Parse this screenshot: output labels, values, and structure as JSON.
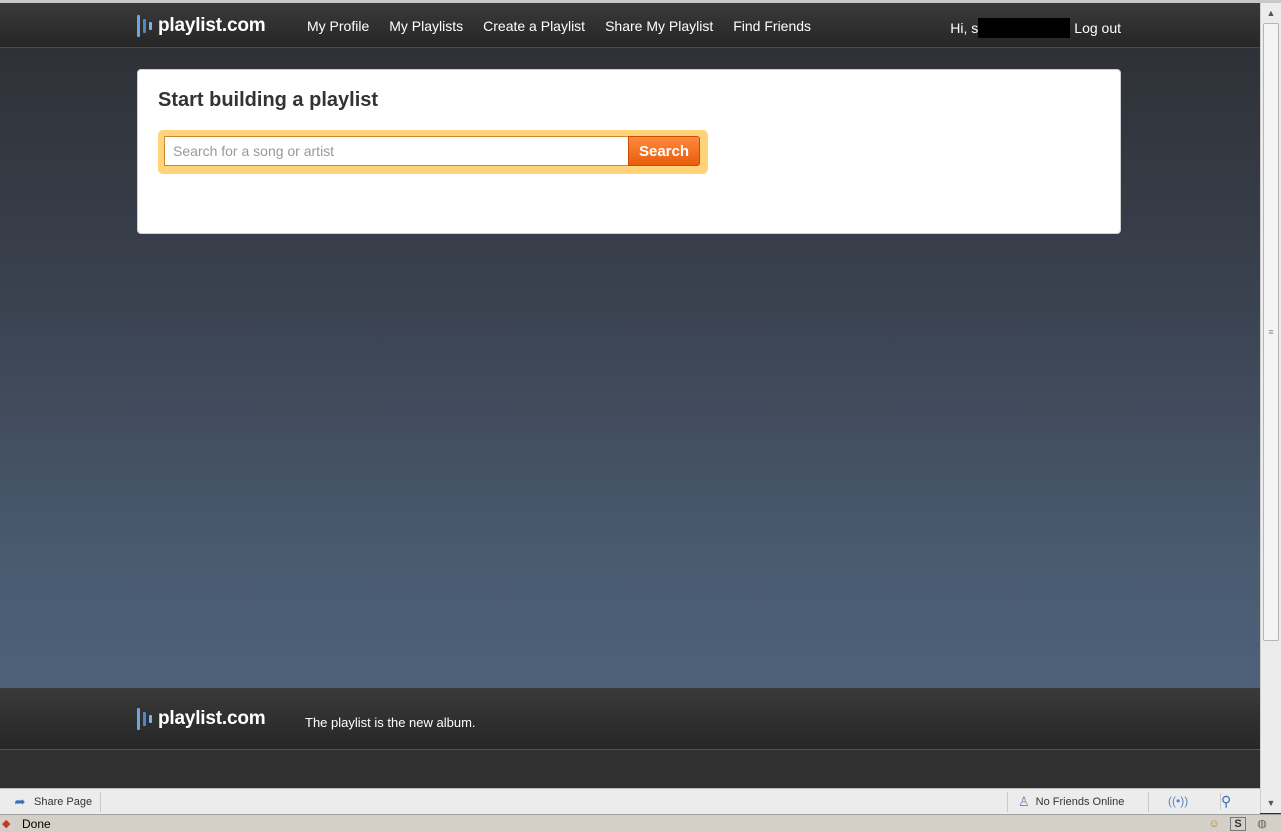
{
  "header": {
    "logo_text": "playlist.com",
    "nav": [
      {
        "label": "My Profile"
      },
      {
        "label": "My Playlists"
      },
      {
        "label": "Create a Playlist"
      },
      {
        "label": "Share My Playlist"
      },
      {
        "label": "Find Friends"
      }
    ],
    "greeting": "Hi, s",
    "logout_label": "Log out"
  },
  "builder": {
    "title": "Start building a playlist",
    "search_placeholder": "Search for a song or artist",
    "search_value": "",
    "search_button": "Search"
  },
  "footer": {
    "logo_text": "playlist.com",
    "tagline": "The playlist is the new album."
  },
  "social_bar": {
    "share_label": "Share Page",
    "friends_label": "No Friends Online"
  },
  "status_bar": {
    "text": "Done"
  },
  "icons": {
    "logo": "equalizer-bars-icon",
    "share": "share-arrow-icon",
    "friends": "person-icon",
    "broadcast": "broadcast-icon",
    "pin": "pin-icon"
  },
  "colors": {
    "search_button": "#e85d0c",
    "search_frame": "#ffd37a",
    "logo_accent": "#5b9bd5"
  }
}
